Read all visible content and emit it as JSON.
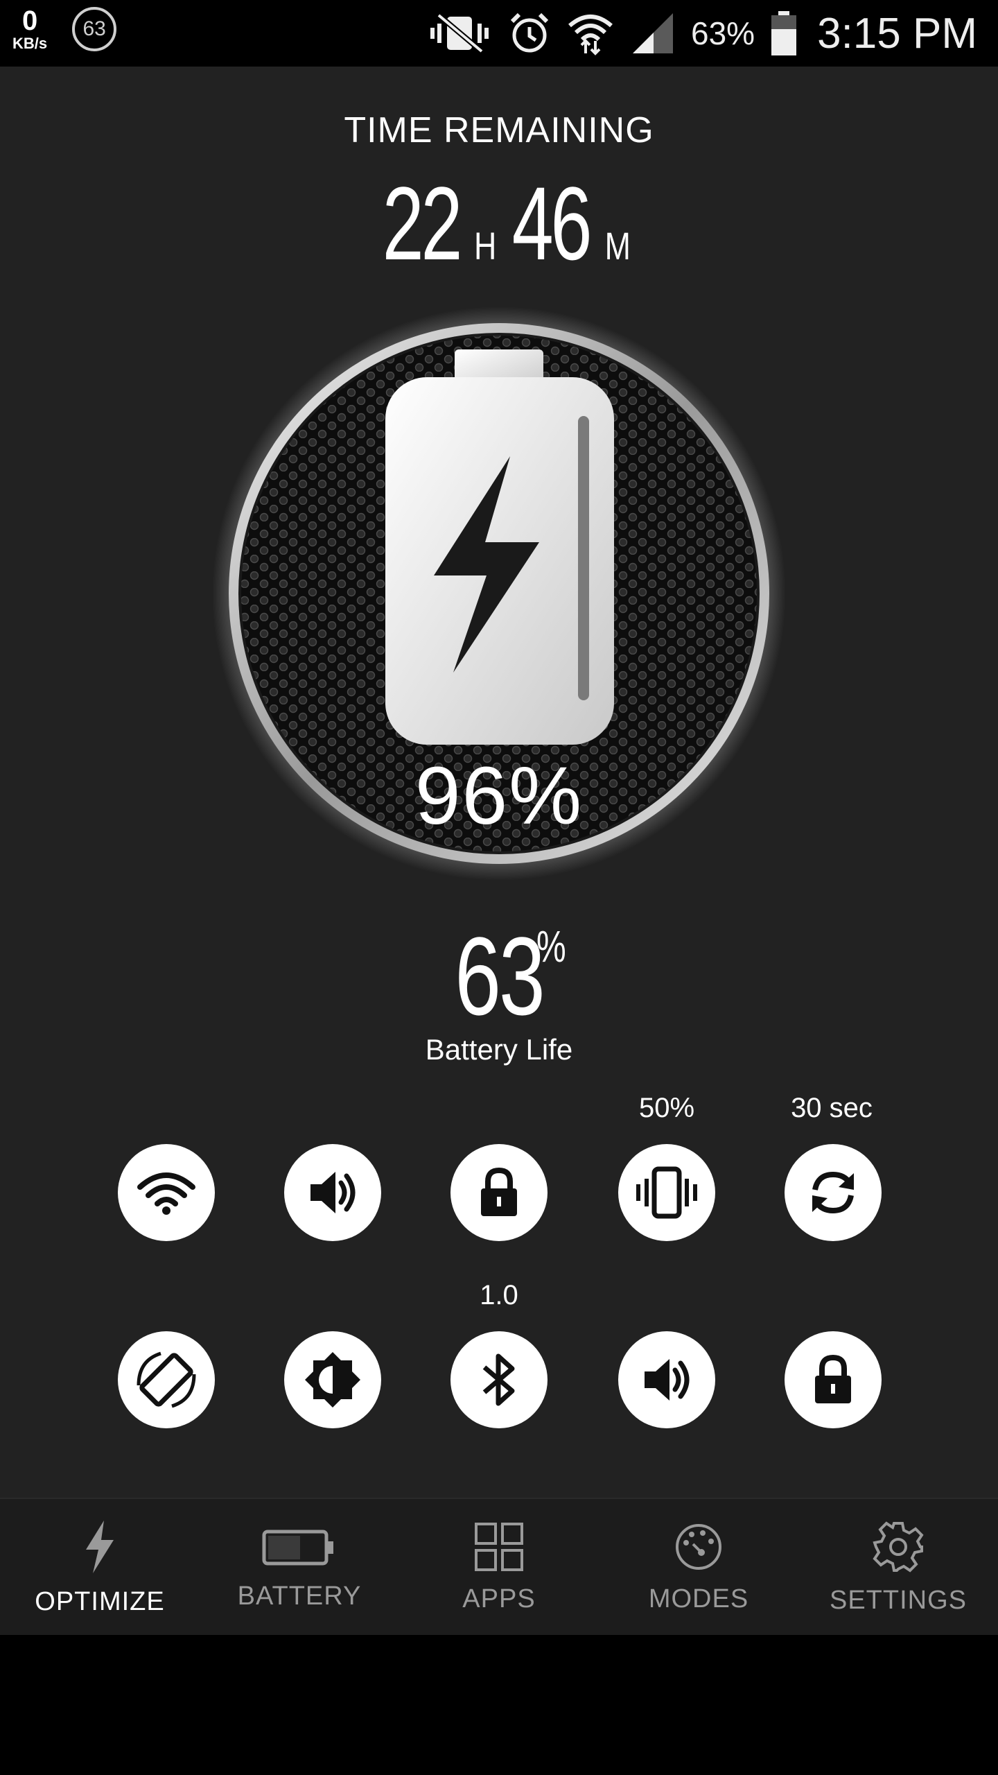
{
  "status_bar": {
    "net_speed_value": "0",
    "net_speed_unit": "KB/s",
    "badge_count": "63",
    "battery_percent": "63%",
    "time": "3:15 PM"
  },
  "main": {
    "title": "TIME REMAINING",
    "hours": "22",
    "hours_unit": "H",
    "minutes": "46",
    "minutes_unit": "M",
    "gauge_percent": "96%",
    "battery_life_value": "63",
    "battery_life_unit": "%",
    "battery_life_label": "Battery Life"
  },
  "toggles_row1": [
    {
      "icon": "wifi-icon",
      "label": ""
    },
    {
      "icon": "volume-icon",
      "label": ""
    },
    {
      "icon": "lock-icon",
      "label": ""
    },
    {
      "icon": "vibrate-icon",
      "label": "50%"
    },
    {
      "icon": "sync-icon",
      "label": "30 sec"
    }
  ],
  "toggles_row2": [
    {
      "icon": "screen-rotation-icon",
      "label": ""
    },
    {
      "icon": "brightness-icon",
      "label": ""
    },
    {
      "icon": "bluetooth-icon",
      "label": "1.0"
    },
    {
      "icon": "volume-icon",
      "label": ""
    },
    {
      "icon": "lock-icon",
      "label": ""
    }
  ],
  "nav": {
    "items": [
      {
        "label": "OPTIMIZE",
        "icon": "bolt-icon",
        "active": true
      },
      {
        "label": "BATTERY",
        "icon": "battery-icon",
        "active": false
      },
      {
        "label": "APPS",
        "icon": "apps-grid-icon",
        "active": false
      },
      {
        "label": "MODES",
        "icon": "modes-dial-icon",
        "active": false
      },
      {
        "label": "SETTINGS",
        "icon": "gear-icon",
        "active": false
      }
    ]
  },
  "colors": {
    "background": "#222222",
    "nav_background": "#1c1c1c",
    "toggle": "#ffffff",
    "inactive_text": "#9a9a9a"
  }
}
